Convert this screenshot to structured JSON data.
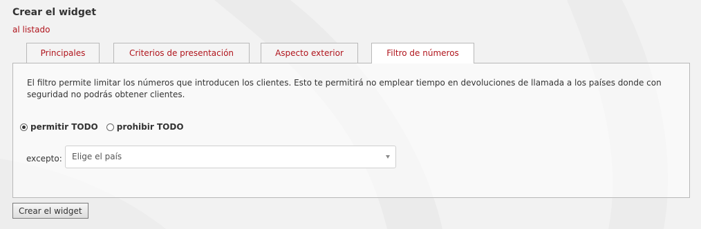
{
  "page": {
    "title": "Crear el widget",
    "back_link": "al listado"
  },
  "tabs": [
    {
      "label": "Principales",
      "active": false
    },
    {
      "label": "Criterios de presentación",
      "active": false
    },
    {
      "label": "Aspecto exterior",
      "active": false
    },
    {
      "label": "Filtro de números",
      "active": true
    }
  ],
  "filter": {
    "description": "El filtro permite limitar los números que introducen los clientes. Esto te permitirá no emplear tiempo en devoluciones de llamada a los países donde con seguridad no podrás obtener clientes.",
    "options": [
      {
        "label": "permitir TODO",
        "checked": true
      },
      {
        "label": "prohibir TODO",
        "checked": false
      }
    ],
    "except_label": "excepto:",
    "country_select_value": "Elige el país"
  },
  "actions": {
    "create_label": "Crear el widget"
  },
  "colors": {
    "accent": "#b0141c",
    "background": "#f2f2f2",
    "border": "#b8b8b8"
  },
  "icons": {
    "radio_checked": "radio-checked-icon",
    "radio_unchecked": "radio-unchecked-icon",
    "dropdown": "caret-down-icon"
  }
}
